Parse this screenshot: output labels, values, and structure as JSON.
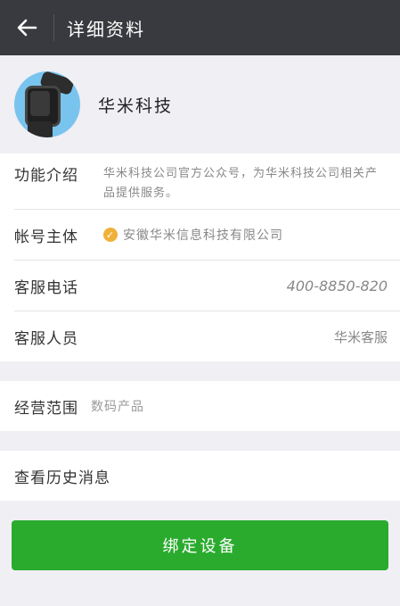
{
  "header": {
    "title": "详细资料"
  },
  "profile": {
    "name": "华米科技"
  },
  "info": {
    "intro_label": "功能介绍",
    "intro_value": "华米科技公司官方公众号，为华米科技公司相关产品提供服务。",
    "account_label": "帐号主体",
    "account_value": "安徽华米信息科技有限公司",
    "phone_label": "客服电话",
    "phone_value": "400-8850-820",
    "staff_label": "客服人员",
    "staff_value": "华米客服"
  },
  "business": {
    "label": "经营范围",
    "value": "数码产品"
  },
  "history": {
    "label": "查看历史消息"
  },
  "bind_button": {
    "label": "绑定设备"
  }
}
